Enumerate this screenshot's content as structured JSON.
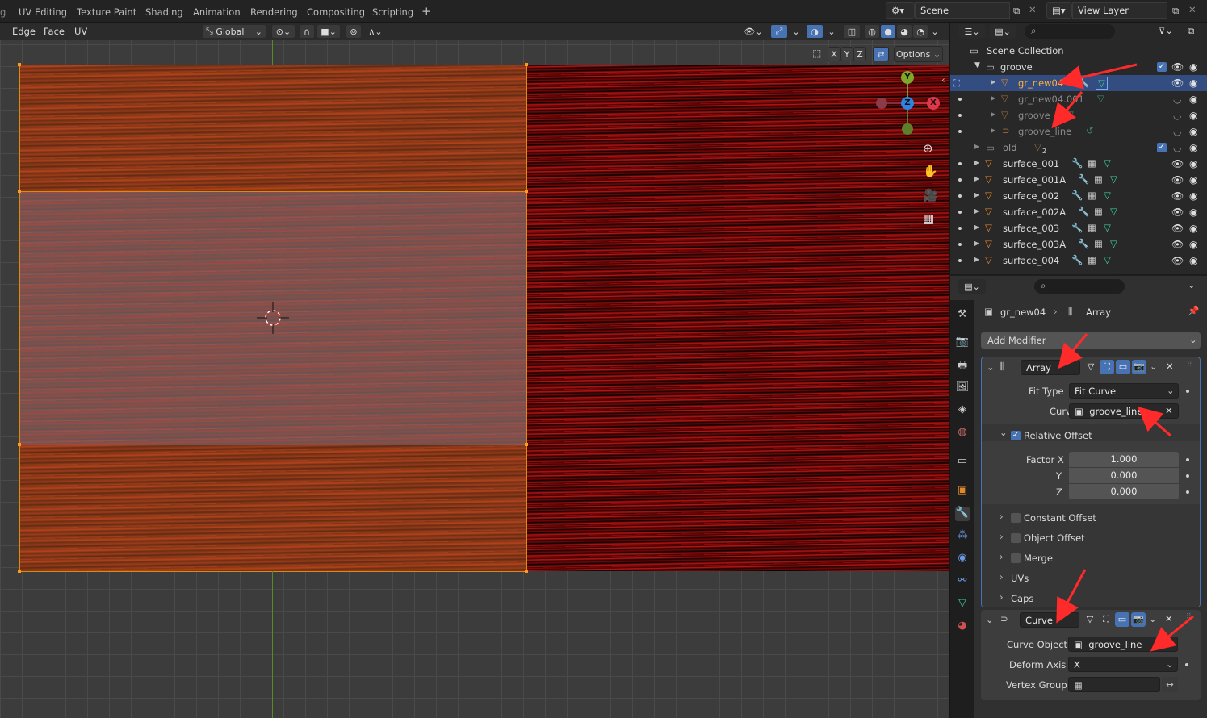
{
  "topbar": {
    "workspace_tabs": [
      "UV Editing",
      "Texture Paint",
      "Shading",
      "Animation",
      "Rendering",
      "Compositing",
      "Scripting"
    ],
    "add_tab": "+",
    "scene_label": "Scene",
    "view_layer_label": "View Layer"
  },
  "viewport_header": {
    "menus": [
      "Edge",
      "Face",
      "UV"
    ],
    "transform_orientation": "Global",
    "axis_buttons": [
      "X",
      "Y",
      "Z"
    ],
    "options_label": "Options"
  },
  "gizmo": {
    "x": "X",
    "y": "Y",
    "z": "Z"
  },
  "outliner": {
    "title": "Scene Collection",
    "rows": [
      {
        "name": "groove",
        "type": "collection",
        "expanded": true,
        "selected": false,
        "dim": false
      },
      {
        "name": "gr_new04",
        "type": "mesh",
        "selected": true,
        "dim": false
      },
      {
        "name": "gr_new04.001",
        "type": "mesh",
        "selected": false,
        "dim": true
      },
      {
        "name": "groove",
        "type": "mesh",
        "selected": false,
        "dim": true
      },
      {
        "name": "groove_line",
        "type": "curve",
        "selected": false,
        "dim": true
      },
      {
        "name": "old",
        "type": "collection",
        "selected": false,
        "dim": true,
        "badge": "2"
      },
      {
        "name": "surface_001",
        "type": "mesh",
        "selected": false,
        "dim": false
      },
      {
        "name": "surface_001A",
        "type": "mesh",
        "selected": false,
        "dim": false
      },
      {
        "name": "surface_002",
        "type": "mesh",
        "selected": false,
        "dim": false
      },
      {
        "name": "surface_002A",
        "type": "mesh",
        "selected": false,
        "dim": false
      },
      {
        "name": "surface_003",
        "type": "mesh",
        "selected": false,
        "dim": false
      },
      {
        "name": "surface_003A",
        "type": "mesh",
        "selected": false,
        "dim": false
      },
      {
        "name": "surface_004",
        "type": "mesh",
        "selected": false,
        "dim": false
      }
    ]
  },
  "properties": {
    "breadcrumb_object": "gr_new04",
    "breadcrumb_modifier": "Array",
    "add_modifier_label": "Add Modifier",
    "array": {
      "name": "Array",
      "fit_type_label": "Fit Type",
      "fit_type_value": "Fit Curve",
      "curve_label": "Curve",
      "curve_value": "groove_line",
      "relative_offset_label": "Relative Offset",
      "factor_x_label": "Factor X",
      "factor_x": "1.000",
      "y_label": "Y",
      "factor_y": "0.000",
      "z_label": "Z",
      "factor_z": "0.000",
      "constant_offset_label": "Constant Offset",
      "object_offset_label": "Object Offset",
      "merge_label": "Merge",
      "uvs_label": "UVs",
      "caps_label": "Caps"
    },
    "curve_mod": {
      "name": "Curve",
      "curve_object_label": "Curve Object",
      "curve_object_value": "groove_line",
      "deform_axis_label": "Deform Axis",
      "deform_axis_value": "X",
      "vertex_group_label": "Vertex Group"
    }
  },
  "colors": {
    "accent_blue": "#4772b3",
    "selection_row": "#334d80",
    "edge_orange": "#d98b12",
    "annotation_red": "#ff2a2a"
  }
}
